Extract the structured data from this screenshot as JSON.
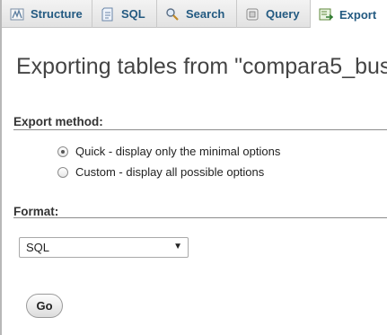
{
  "tabs": [
    {
      "label": "Structure",
      "icon": "structure-icon",
      "active": false
    },
    {
      "label": "SQL",
      "icon": "sql-icon",
      "active": false
    },
    {
      "label": "Search",
      "icon": "search-icon",
      "active": false
    },
    {
      "label": "Query",
      "icon": "query-icon",
      "active": false
    },
    {
      "label": "Export",
      "icon": "export-icon",
      "active": true
    }
  ],
  "page_title": "Exporting tables from \"compara5_bus",
  "export_method": {
    "legend": "Export method:",
    "options": [
      {
        "label": "Quick - display only the minimal options",
        "checked": true
      },
      {
        "label": "Custom - display all possible options",
        "checked": false
      }
    ]
  },
  "format": {
    "legend": "Format:",
    "selected": "SQL"
  },
  "go_label": "Go",
  "colors": {
    "tab_text": "#235a81",
    "tabbar_bg": "#e8e8e8",
    "title_text": "#444444"
  }
}
